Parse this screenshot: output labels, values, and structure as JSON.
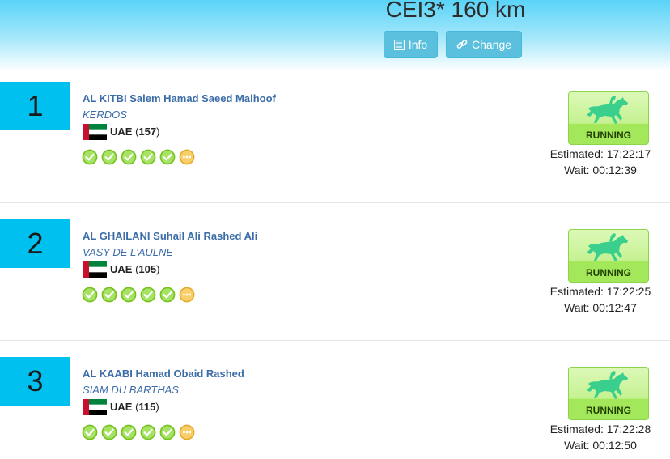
{
  "header": {
    "title": "CEI3* 160 km",
    "info_label": "Info",
    "change_label": "Change"
  },
  "colors": {
    "accent": "#00c0ef",
    "button": "#5bc0de",
    "check": "#8dd638",
    "pending": "#f5c04a",
    "link": "#3c6da8"
  },
  "entries": [
    {
      "rank": "1",
      "rider": "AL KITBI Salem Hamad Saeed Malhoof",
      "horse": "KERDOS",
      "country": "UAE",
      "number": "157",
      "phases": [
        "done",
        "done",
        "done",
        "done",
        "done",
        "pending"
      ],
      "status": "RUNNING",
      "estimated": "Estimated: 17:22:17",
      "wait": "Wait: 00:12:39"
    },
    {
      "rank": "2",
      "rider": "AL GHAILANI Suhail Ali Rashed Ali",
      "horse": "VASY DE L'AULNE",
      "country": "UAE",
      "number": "105",
      "phases": [
        "done",
        "done",
        "done",
        "done",
        "done",
        "pending"
      ],
      "status": "RUNNING",
      "estimated": "Estimated: 17:22:25",
      "wait": "Wait: 00:12:47"
    },
    {
      "rank": "3",
      "rider": "AL KAABI Hamad Obaid Rashed",
      "horse": "SIAM DU BARTHAS",
      "country": "UAE",
      "number": "115",
      "phases": [
        "done",
        "done",
        "done",
        "done",
        "done",
        "pending"
      ],
      "status": "RUNNING",
      "estimated": "Estimated: 17:22:28",
      "wait": "Wait: 00:12:50"
    }
  ]
}
